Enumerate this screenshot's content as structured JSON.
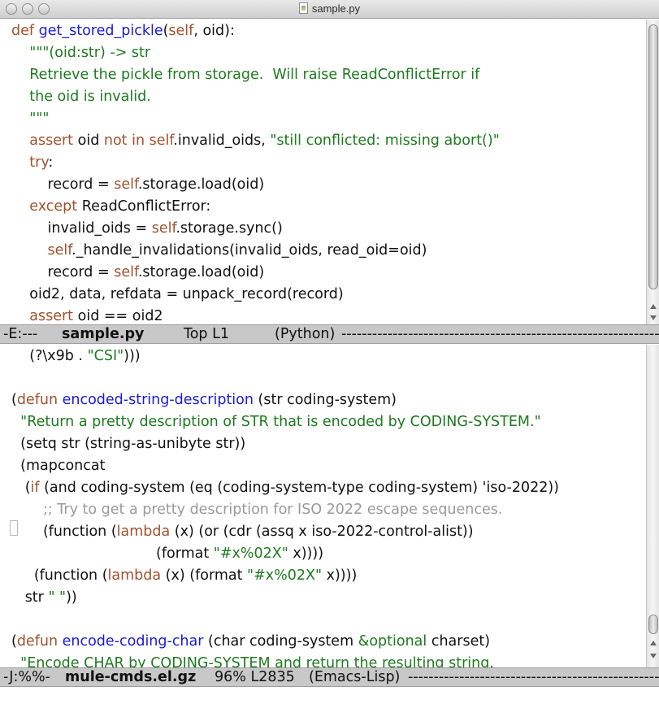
{
  "window": {
    "title": "sample.py"
  },
  "top_pane": {
    "lines": [
      [
        [
          "kw",
          "def"
        ],
        [
          "plain",
          " "
        ],
        [
          "fn",
          "get_stored_pickle"
        ],
        [
          "plain",
          "("
        ],
        [
          "kw",
          "self"
        ],
        [
          "plain",
          ", oid):"
        ]
      ],
      [
        [
          "plain",
          "    "
        ],
        [
          "str",
          "\"\"\"(oid:str) -> str"
        ]
      ],
      [
        [
          "plain",
          "    "
        ],
        [
          "str",
          "Retrieve the pickle from storage.  Will raise ReadConflictError if"
        ]
      ],
      [
        [
          "plain",
          "    "
        ],
        [
          "str",
          "the oid is invalid."
        ]
      ],
      [
        [
          "plain",
          "    "
        ],
        [
          "str",
          "\"\"\""
        ]
      ],
      [
        [
          "plain",
          "    "
        ],
        [
          "kw",
          "assert"
        ],
        [
          "plain",
          " oid "
        ],
        [
          "kw",
          "not in"
        ],
        [
          "plain",
          " "
        ],
        [
          "kw",
          "self"
        ],
        [
          "plain",
          ".invalid_oids, "
        ],
        [
          "str",
          "\"still conflicted: missing abort()\""
        ]
      ],
      [
        [
          "plain",
          "    "
        ],
        [
          "kw",
          "try"
        ],
        [
          "plain",
          ":"
        ]
      ],
      [
        [
          "plain",
          "        record = "
        ],
        [
          "kw",
          "self"
        ],
        [
          "plain",
          ".storage.load(oid)"
        ]
      ],
      [
        [
          "plain",
          "    "
        ],
        [
          "kw",
          "except"
        ],
        [
          "plain",
          " ReadConflictError:"
        ]
      ],
      [
        [
          "plain",
          "        invalid_oids = "
        ],
        [
          "kw",
          "self"
        ],
        [
          "plain",
          ".storage.sync()"
        ]
      ],
      [
        [
          "plain",
          "        "
        ],
        [
          "kw",
          "self"
        ],
        [
          "plain",
          "._handle_invalidations(invalid_oids, read_oid=oid)"
        ]
      ],
      [
        [
          "plain",
          "        record = "
        ],
        [
          "kw",
          "self"
        ],
        [
          "plain",
          ".storage.load(oid)"
        ]
      ],
      [
        [
          "plain",
          "    oid2, data, refdata = unpack_record(record)"
        ]
      ],
      [
        [
          "plain",
          "    "
        ],
        [
          "kw",
          "assert"
        ],
        [
          "plain",
          " oid == oid2"
        ]
      ]
    ]
  },
  "top_modeline": {
    "status": "-E:---",
    "buffer": "sample.py",
    "position": "Top L1",
    "mode": "(Python)",
    "fill": "--------------------------------------------------------------"
  },
  "bottom_pane": {
    "lines": [
      [
        [
          "plain",
          "    (?\\x9b . "
        ],
        [
          "str",
          "\"CSI\""
        ],
        [
          "plain",
          ")))"
        ]
      ],
      [
        [
          "plain",
          ""
        ]
      ],
      [
        [
          "plain",
          "("
        ],
        [
          "kw",
          "defun"
        ],
        [
          "plain",
          " "
        ],
        [
          "fn",
          "encoded-string-description"
        ],
        [
          "plain",
          " (str coding-system)"
        ]
      ],
      [
        [
          "plain",
          "  "
        ],
        [
          "str",
          "\"Return a pretty description of STR that is encoded by CODING-SYSTEM.\""
        ]
      ],
      [
        [
          "plain",
          "  (setq str (string-as-unibyte str))"
        ]
      ],
      [
        [
          "plain",
          "  (mapconcat"
        ]
      ],
      [
        [
          "plain",
          "   ("
        ],
        [
          "kw",
          "if"
        ],
        [
          "plain",
          " (and coding-system (eq (coding-system-type coding-system) 'iso-2022))"
        ]
      ],
      [
        [
          "cmt",
          "       ;; Try to get a pretty description for ISO 2022 escape sequences."
        ]
      ],
      [
        [
          "plain",
          "       (function ("
        ],
        [
          "kw",
          "lambda"
        ],
        [
          "plain",
          " (x) (or (cdr (assq x iso-2022-control-alist))"
        ]
      ],
      [
        [
          "plain",
          "                                (format "
        ],
        [
          "str",
          "\"#x%02X\""
        ],
        [
          "plain",
          " x))))"
        ]
      ],
      [
        [
          "plain",
          "     (function ("
        ],
        [
          "kw",
          "lambda"
        ],
        [
          "plain",
          " (x) (format "
        ],
        [
          "str",
          "\"#x%02X\""
        ],
        [
          "plain",
          " x))))"
        ]
      ],
      [
        [
          "plain",
          "   str "
        ],
        [
          "str",
          "\" \""
        ],
        [
          "plain",
          "))"
        ]
      ],
      [
        [
          "plain",
          ""
        ]
      ],
      [
        [
          "plain",
          "("
        ],
        [
          "kw",
          "defun"
        ],
        [
          "plain",
          " "
        ],
        [
          "fn",
          "encode-coding-char"
        ],
        [
          "plain",
          " (char coding-system "
        ],
        [
          "str",
          "&optional"
        ],
        [
          "plain",
          " charset)"
        ]
      ],
      [
        [
          "plain",
          "  "
        ],
        [
          "str",
          "\"Encode CHAR by CODING-SYSTEM and return the resulting string."
        ]
      ]
    ]
  },
  "bottom_modeline": {
    "status": "-J:%%-",
    "buffer": "mule-cmds.el.gz",
    "position": "96% L2835",
    "mode": "(Emacs-Lisp)",
    "fill": "-------------------------------------------------"
  }
}
